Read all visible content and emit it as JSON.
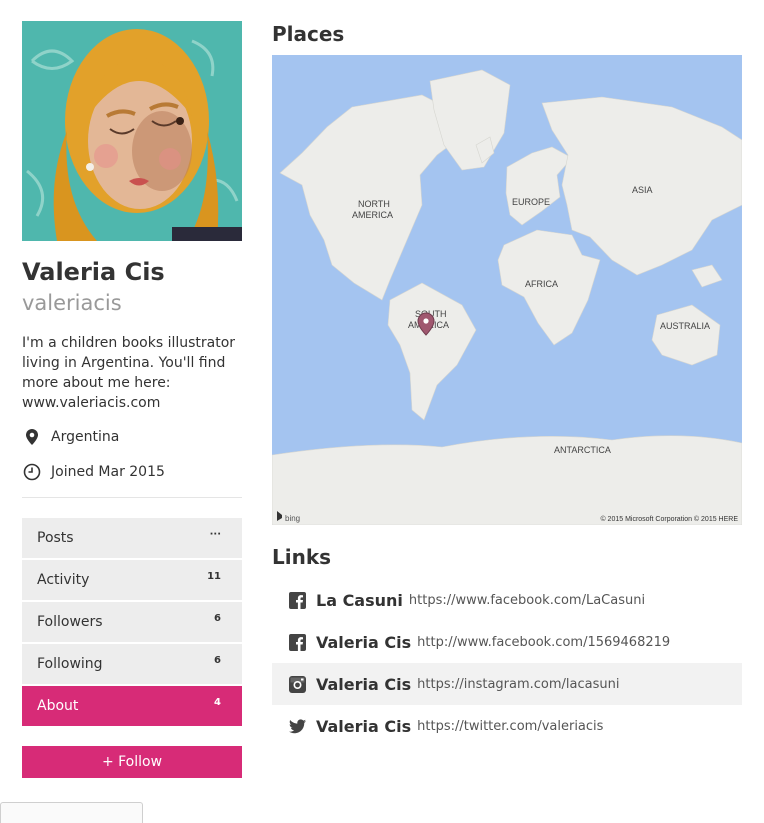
{
  "profile": {
    "name": "Valeria Cis",
    "username": "valeriacis",
    "bio": "I'm a children books illustrator living in Argentina. You'll find more about me here: www.valeriacis.com",
    "location": "Argentina",
    "joined": "Joined Mar 2015"
  },
  "nav": [
    {
      "label": "Posts",
      "count": "···"
    },
    {
      "label": "Activity",
      "count": "11"
    },
    {
      "label": "Followers",
      "count": "6"
    },
    {
      "label": "Following",
      "count": "6"
    },
    {
      "label": "About",
      "count": "4"
    }
  ],
  "follow_label": "+  Follow",
  "places": {
    "title": "Places",
    "map": {
      "labels": {
        "north_america": [
          "NORTH",
          "AMERICA"
        ],
        "europe": "EUROPE",
        "asia": "ASIA",
        "africa": "AFRICA",
        "south_america": [
          "SOUTH",
          "AMERICA"
        ],
        "australia": "AUSTRALIA",
        "antarctica": "ANTARCTICA"
      },
      "provider": "bing",
      "copyright": "© 2015 Microsoft Corporation © 2015 HERE"
    }
  },
  "links": {
    "title": "Links",
    "items": [
      {
        "icon": "facebook-icon",
        "name": "La Casuni",
        "url": "https://www.facebook.com/LaCasuni"
      },
      {
        "icon": "facebook-icon",
        "name": "Valeria Cis",
        "url": "http://www.facebook.com/1569468219"
      },
      {
        "icon": "instagram-icon",
        "name": "Valeria Cis",
        "url": "https://instagram.com/lacasuni"
      },
      {
        "icon": "twitter-icon",
        "name": "Valeria Cis",
        "url": "https://twitter.com/valeriacis"
      }
    ]
  },
  "colors": {
    "accent": "#d72b77",
    "ocean": "#a4c4f0",
    "land": "#ededea",
    "nav_bg": "#ededed"
  }
}
